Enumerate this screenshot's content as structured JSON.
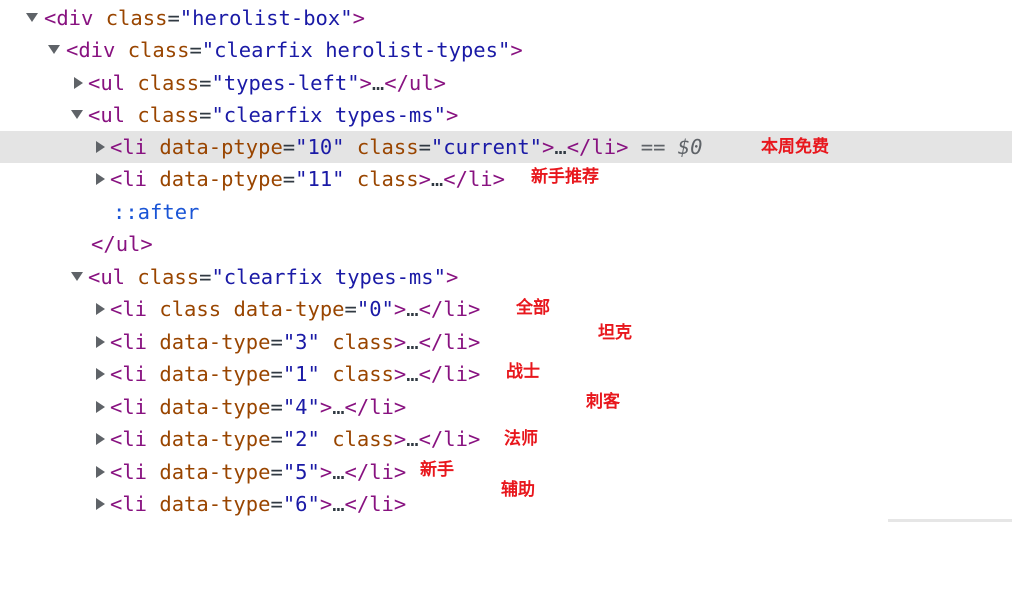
{
  "lines": {
    "l1": {
      "tag": "div",
      "attr1": "class",
      "val1": "\"herolist-box\""
    },
    "l2": {
      "tag": "div",
      "attr1": "class",
      "val1": "\"clearfix herolist-types\""
    },
    "l3": {
      "tag": "ul",
      "attr1": "class",
      "val1": "\"types-left\"",
      "close": "ul"
    },
    "l4": {
      "tag": "ul",
      "attr1": "class",
      "val1": "\"clearfix types-ms\""
    },
    "l5": {
      "tag": "li",
      "attr1": "data-ptype",
      "val1": "\"10\"",
      "attr2": "class",
      "val2": "\"current\"",
      "close": "li",
      "eq": "==",
      "dollar": "$0"
    },
    "l6": {
      "tag": "li",
      "attr1": "data-ptype",
      "val1": "\"11\"",
      "attr2": "class",
      "close": "li"
    },
    "l7": {
      "pseudo": "::after"
    },
    "l8": {
      "close": "ul"
    },
    "l9": {
      "tag": "ul",
      "attr1": "class",
      "val1": "\"clearfix types-ms\""
    },
    "l10": {
      "tag": "li",
      "attr1": "class",
      "attr2": "data-type",
      "val2": "\"0\"",
      "close": "li"
    },
    "l11": {
      "tag": "li",
      "attr1": "data-type",
      "val1": "\"3\"",
      "attr2": "class",
      "close": "li"
    },
    "l12": {
      "tag": "li",
      "attr1": "data-type",
      "val1": "\"1\"",
      "attr2": "class",
      "close": "li"
    },
    "l13": {
      "tag": "li",
      "attr1": "data-type",
      "val1": "\"4\"",
      "close": "li"
    },
    "l14": {
      "tag": "li",
      "attr1": "data-type",
      "val1": "\"2\"",
      "attr2": "class",
      "close": "li"
    },
    "l15": {
      "tag": "li",
      "attr1": "data-type",
      "val1": "\"5\"",
      "close": "li"
    },
    "l16": {
      "tag": "li",
      "attr1": "data-type",
      "val1": "\"6\"",
      "close": "li"
    }
  },
  "annotations": {
    "free_week": "本周免费",
    "newbie_recommend": "新手推荐",
    "all": "全部",
    "tank": "坦克",
    "warrior": "战士",
    "assassin": "刺客",
    "mage": "法师",
    "newbie": "新手",
    "support": "辅助"
  },
  "colors": {
    "tag": "#881280",
    "attr": "#994500",
    "value": "#1a1aa6",
    "annotation": "#e8171d",
    "selected_row": "#e4e4e4"
  }
}
